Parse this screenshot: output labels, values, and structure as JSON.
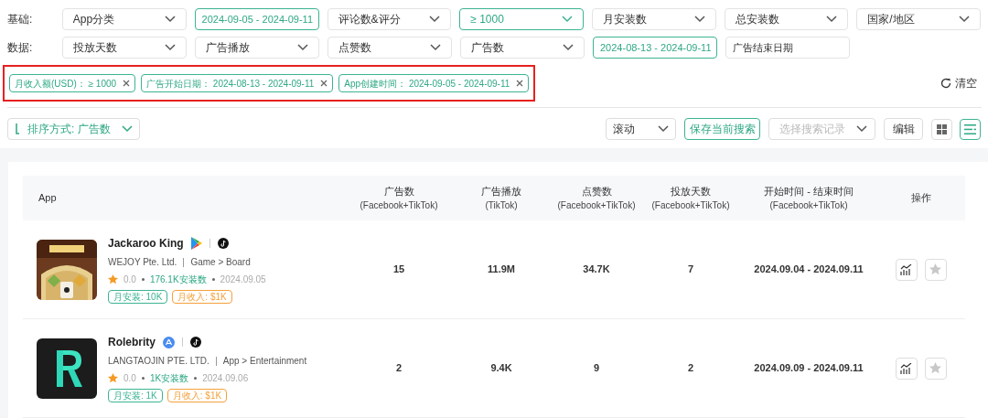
{
  "filter_rows": [
    {
      "label": "基础:",
      "items": [
        {
          "text": "App分类",
          "kind": "select",
          "active": false
        },
        {
          "text": "2024-09-05 - 2024-09-11",
          "kind": "range",
          "active": true
        },
        {
          "text": "评论数&评分",
          "kind": "select",
          "active": false
        },
        {
          "text": "≥ 1000",
          "kind": "select",
          "active": true
        },
        {
          "text": "月安装数",
          "kind": "select",
          "active": false
        },
        {
          "text": "总安装数",
          "kind": "select",
          "active": false
        },
        {
          "text": "国家/地区",
          "kind": "select",
          "active": false
        }
      ]
    },
    {
      "label": "数据:",
      "items": [
        {
          "text": "投放天数",
          "kind": "select",
          "active": false
        },
        {
          "text": "广告播放",
          "kind": "select",
          "active": false
        },
        {
          "text": "点赞数",
          "kind": "select",
          "active": false
        },
        {
          "text": "广告数",
          "kind": "select",
          "active": false
        },
        {
          "text": "2024-08-13 - 2024-09-11",
          "kind": "range",
          "active": true
        },
        {
          "text": "广告结束日期",
          "kind": "range",
          "active": false
        }
      ]
    }
  ],
  "chips": [
    {
      "text": "月收入额(USD)： ≥ 1000"
    },
    {
      "text": "广告开始日期： 2024-08-13 - 2024-09-11"
    },
    {
      "text": "App创建时间： 2024-09-05 - 2024-09-11"
    }
  ],
  "clear_button": "清空",
  "sort_button": "排序方式: 广告数",
  "mode_select": "滚动",
  "save_button": "保存当前搜索",
  "history_select": {
    "placeholder": "选择搜索记录"
  },
  "edit_button": "编辑",
  "view_toggles": [
    {
      "kind": "grid",
      "selected": false
    },
    {
      "kind": "list",
      "selected": true
    }
  ],
  "table": {
    "columns": [
      {
        "title": "App"
      },
      {
        "title": "广告数",
        "subtitle": "(Facebook+TikTok)"
      },
      {
        "title": "广告播放",
        "subtitle": "(TikTok)"
      },
      {
        "title": "点赞数",
        "subtitle": "(Facebook+TikTok)"
      },
      {
        "title": "投放天数",
        "subtitle": "(Facebook+TikTok)"
      },
      {
        "title": "开始时间 - 结束时间",
        "subtitle": "(Facebook+TikTok)"
      },
      {
        "title": "操作"
      }
    ],
    "rows": [
      {
        "name": "Jackaroo King",
        "kind": "play",
        "developer": "WEJOY Pte. Ltd.",
        "category": "Game > Board",
        "rating": "0.0",
        "installs": "176.1K安装数",
        "date": "2024.09.05",
        "tags": [
          {
            "text": "月安装: 10K",
            "color": "#3cb393"
          },
          {
            "text": "月收入: $1K",
            "color": "#f5a13c"
          }
        ],
        "values": [
          "15",
          "11.9M",
          "34.7K",
          "7",
          "2024.09.04 - 2024.09.11"
        ]
      },
      {
        "name": "Rolebrity",
        "kind": "appstore",
        "developer": "LANGTAOJIN PTE. LTD.",
        "category": "App > Entertainment",
        "rating": "0.0",
        "installs": "1K安装数",
        "date": "2024.09.06",
        "tags": [
          {
            "text": "月安装: 1K",
            "color": "#3cb393"
          },
          {
            "text": "月收入: $1K",
            "color": "#f5a13c"
          }
        ],
        "values": [
          "2",
          "9.4K",
          "9",
          "2",
          "2024.09.09 - 2024.09.11"
        ]
      }
    ]
  }
}
